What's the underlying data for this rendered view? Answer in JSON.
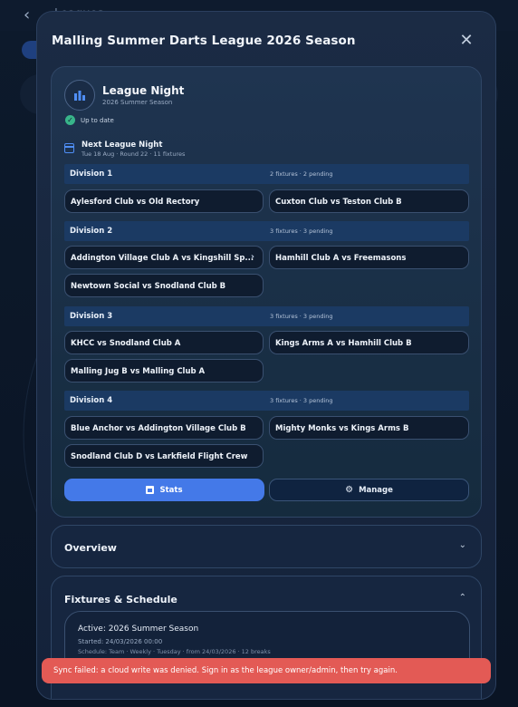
{
  "background": {
    "back_glyph": "‹",
    "title": "Leagues"
  },
  "modal": {
    "title": "Malling Summer Darts League 2026 Season",
    "close_glyph": "✕"
  },
  "league_night": {
    "icon": "bar-chart-icon",
    "title": "League Night",
    "subtitle": "2026 Summer Season",
    "status": "Up to date",
    "next_title": "Next League Night",
    "next_sub": "Tue 18 Aug · Round 22 · 11 fixtures"
  },
  "divisions": [
    {
      "name": "Division 1",
      "meta": "2 fixtures · 2 pending",
      "fixtures": [
        "Aylesford Club vs Old Rectory",
        "Cuxton Club vs Teston Club B"
      ]
    },
    {
      "name": "Division 2",
      "meta": "3 fixtures · 3 pending",
      "fixtures": [
        "Addington Village Club A vs Kingshill Sp...",
        "Hamhill Club A vs Freemasons",
        "Newtown Social vs Snodland Club B"
      ]
    },
    {
      "name": "Division 3",
      "meta": "3 fixtures · 3 pending",
      "fixtures": [
        "KHCC vs Snodland Club A",
        "Kings Arms A vs Hamhill Club B",
        "Malling Jug B vs Malling Club A"
      ]
    },
    {
      "name": "Division 4",
      "meta": "3 fixtures · 3 pending",
      "fixtures": [
        "Blue Anchor vs Addington Village Club B",
        "Mighty Monks vs Kings Arms B",
        "Snodland Club D vs Larkfield Flight Crew"
      ]
    }
  ],
  "actions": {
    "stats_label": "Stats",
    "manage_label": "Manage"
  },
  "overview": {
    "title": "Overview",
    "chevron": "⌄"
  },
  "fixtures_schedule": {
    "title": "Fixtures & Schedule",
    "chevron": "⌃",
    "active_season": "Active: 2026 Summer Season",
    "started": "Started: 24/03/2026 00:00",
    "schedule": "Schedule: Team · Weekly · Tuesday · from 24/03/2026 · 12 breaks"
  },
  "toast": {
    "message": "Sync failed: a cloud write was denied. Sign in as the league owner/admin, then try again."
  },
  "colors": {
    "accent": "#4479e8",
    "success": "#38b58a",
    "error": "#e35a55"
  }
}
